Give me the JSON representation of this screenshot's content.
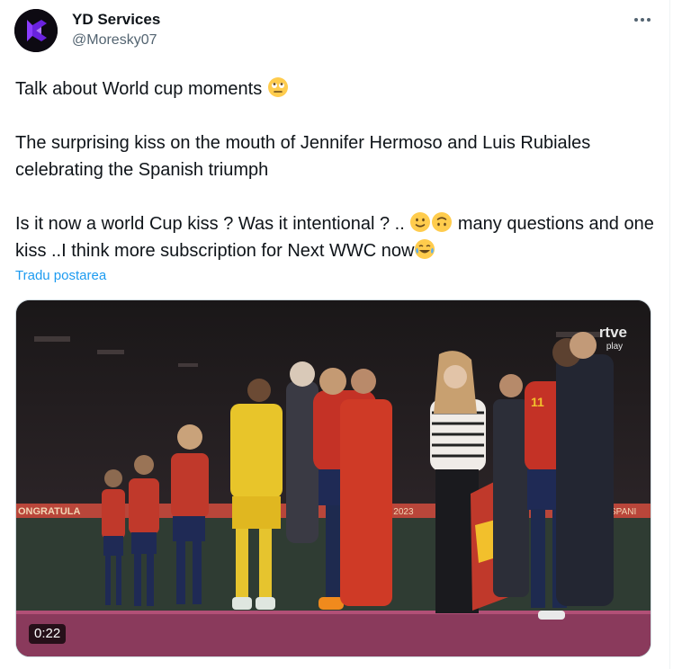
{
  "author": {
    "display_name": "YD Services",
    "handle": "@Moresky07"
  },
  "tweet": {
    "line1": "Talk about World cup moments ",
    "line1_emoji": "face-with-rolling-eyes",
    "line2": "The surprising kiss on the mouth of Jennifer Hermoso and Luis Rubiales celebrating the Spanish triumph",
    "line3a": "Is it now a world Cup kiss ? Was it intentional ? .. ",
    "line3_emojis": [
      "slightly-smiling-face",
      "upside-down-face"
    ],
    "line3b": "  many questions and one kiss ..I think   more subscription for Next WWC now",
    "line3_end_emoji": "face-with-tears-of-joy"
  },
  "translate_label": "Tradu postarea",
  "video": {
    "duration": "0:22",
    "watermark": "rtve",
    "watermark_sub": "play",
    "banner_left": "ONGRATULA",
    "banner_mid": "P 2023",
    "banner_right": "SPANI"
  },
  "colors": {
    "link": "#1d9bf0",
    "secondary_text": "#536471",
    "avatar_accent": "#7b2cf5"
  }
}
